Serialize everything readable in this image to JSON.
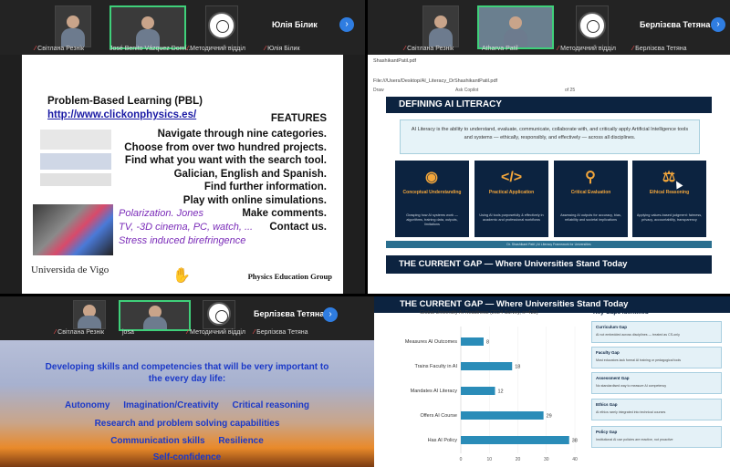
{
  "q1": {
    "participants": [
      {
        "name": "Світлана Резнік"
      },
      {
        "name": "José Benito Vázquez Domí..."
      },
      {
        "name": "Методичний відділ"
      },
      {
        "name": "Юлія Білик"
      }
    ],
    "slide": {
      "title": "Problem-Based Learning (PBL)",
      "link": "http://www.clickonphysics.es/",
      "features_label": "FEATURES",
      "features": [
        "Navigate through nine categories.",
        "Choose from over two hundred projects.",
        "Find what you want with the search tool.",
        "Galician, English and Spanish.",
        "Find further information.",
        "Play with online simulations.",
        "Make comments.",
        "Contact us."
      ],
      "polarization_lines": [
        "Polarization. Jones",
        "TV, -3D cinema, PC, watch, ...",
        "Stress induced birefringence"
      ],
      "university": "Universida de Vigo",
      "logo_text": "clickonphysics",
      "group": "Physics Education Group"
    }
  },
  "q2": {
    "participants": [
      {
        "name": "Світлана Резнік"
      },
      {
        "name": "Atharva Patil"
      },
      {
        "name": "Методичний відділ"
      },
      {
        "name": "Берлізєва Тетяна"
      }
    ],
    "browser": {
      "tab": "ShashikantPatil.pdf",
      "path": "File:///Users/Desktop/AI_Literacy_DrShashikantPatil.pdf",
      "tools": [
        "Draw",
        "Ask Copilot",
        "of 25"
      ]
    },
    "doc": {
      "heading": "DEFINING AI LITERACY",
      "definition": "AI Literacy is the ability to understand, evaluate, communicate, collaborate with, and critically apply Artificial Intelligence tools and systems — ethically, responsibly, and effectively — across all disciplines.",
      "cards": [
        {
          "icon": "brain-icon",
          "glyph": "◉",
          "title": "Conceptual Understanding",
          "text": "Grasping how AI systems work — algorithms, training data, outputs, limitations"
        },
        {
          "icon": "code-icon",
          "glyph": "</>",
          "title": "Practical Application",
          "text": "Using AI tools purposefully & effectively in academic and professional workflows"
        },
        {
          "icon": "magnifier-icon",
          "glyph": "⚲",
          "title": "Critical Evaluation",
          "text": "Assessing AI outputs for accuracy, bias, reliability and societal implications"
        },
        {
          "icon": "scales-icon",
          "glyph": "⚖",
          "title": "Ethical Reasoning",
          "text": "Applying values-based judgment: fairness, privacy, accountability, transparency"
        }
      ],
      "footer": "Dr. Shashikant Patil | AI Literacy Framework for Universities",
      "gap_heading": "THE CURRENT GAP — Where Universities Stand Today"
    }
  },
  "q3": {
    "participants": [
      {
        "name": "Світлана Резнік"
      },
      {
        "name": "josa"
      },
      {
        "name": "Методичний відділ"
      },
      {
        "name": "Берлізєва Тетяна"
      }
    ],
    "slide": {
      "line1": "Developing skills and competencies that will be very important to",
      "line2": "the every day life:",
      "skills_row1": [
        "Autonomy",
        "Imagination/Creativity",
        "Critical reasoning"
      ],
      "skills_row2": "Research and problem solving capabilities",
      "skills_row3": [
        "Communication skills",
        "Resilience"
      ],
      "skills_row4": "Self-confidence"
    }
  },
  "q4": {
    "heading": "THE CURRENT GAP — Where Universities Stand Today",
    "gaps_title": "Key Gaps Identified",
    "gaps": [
      {
        "title": "Curriculum Gap",
        "text": "AI not embedded across disciplines — treated as CS-only"
      },
      {
        "title": "Faculty Gap",
        "text": "Most educators lack formal AI training or pedagogical tools"
      },
      {
        "title": "Assessment Gap",
        "text": "No standardised way to measure AI competency"
      },
      {
        "title": "Ethics Gap",
        "text": "AI ethics rarely integrated into technical courses"
      },
      {
        "title": "Policy Gap",
        "text": "Institutional AI use policies are reactive, not proactive"
      }
    ]
  },
  "chart_data": {
    "type": "bar",
    "orientation": "horizontal",
    "title": "Global University AI Readiness (2024 Survey, n=420)",
    "categories": [
      "Measures AI Outcomes",
      "Trains Faculty in AI",
      "Mandates AI Literacy",
      "Offers AI Course",
      "Has AI Policy"
    ],
    "values": [
      8,
      18,
      12,
      29,
      38
    ],
    "xlim": [
      0,
      40
    ],
    "xticks": [
      "0",
      "10",
      "20",
      "30",
      "40"
    ],
    "bar_color": "#2a8cb8"
  }
}
